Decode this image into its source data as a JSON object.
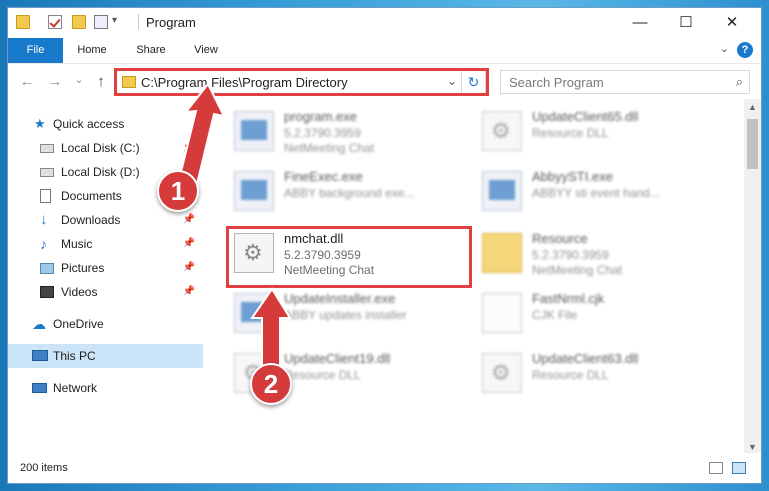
{
  "window": {
    "title": "Program",
    "minimize": "—",
    "maximize": "☐",
    "close": "✕"
  },
  "ribbon": {
    "tabs": [
      "File",
      "Home",
      "Share",
      "View"
    ],
    "help": "?",
    "collapse": "⌄"
  },
  "nav_buttons": {
    "back": "←",
    "forward": "→",
    "recent": "⌄",
    "up": "↑"
  },
  "address": {
    "path": "C:\\Program Files\\Program Directory",
    "dropdown": "⌄",
    "refresh": "↻"
  },
  "search": {
    "placeholder": "Search Program",
    "icon": "⌕"
  },
  "sidebar": {
    "items": [
      {
        "label": "Quick access",
        "icon": "star-icon",
        "pinned": false
      },
      {
        "label": "Local Disk (C:)",
        "icon": "drive-icon",
        "pinned": true
      },
      {
        "label": "Local Disk (D:)",
        "icon": "drive-icon",
        "pinned": true
      },
      {
        "label": "Documents",
        "icon": "documents-icon",
        "pinned": true
      },
      {
        "label": "Downloads",
        "icon": "download-icon",
        "pinned": true
      },
      {
        "label": "Music",
        "icon": "music-icon",
        "pinned": true
      },
      {
        "label": "Pictures",
        "icon": "pictures-icon",
        "pinned": true
      },
      {
        "label": "Videos",
        "icon": "videos-icon",
        "pinned": true
      },
      {
        "label": "OneDrive",
        "icon": "cloud-icon",
        "pinned": false
      },
      {
        "label": "This PC",
        "icon": "computer-icon",
        "pinned": false
      },
      {
        "label": "Network",
        "icon": "network-icon",
        "pinned": false
      }
    ],
    "pin_glyph": "📌"
  },
  "files": [
    {
      "name": "program.exe",
      "line1": "5.2.3790.3959",
      "line2": "NetMeeting Chat",
      "icon": "exe-icon",
      "blurred": true
    },
    {
      "name": "UpdateClient65.dll",
      "line1": "Resource DLL",
      "line2": "",
      "icon": "dll-icon",
      "blurred": true
    },
    {
      "name": "FineExec.exe",
      "line1": "ABBY background exe...",
      "line2": "",
      "icon": "exe-icon",
      "blurred": true
    },
    {
      "name": "AbbyySTI.exe",
      "line1": "ABBYY sti event hand...",
      "line2": "",
      "icon": "exe-icon",
      "blurred": true
    },
    {
      "name": "nmchat.dll",
      "line1": "5.2.3790.3959",
      "line2": "NetMeeting Chat",
      "icon": "dll-icon",
      "blurred": false
    },
    {
      "name": "Resource",
      "line1": "5.2.3790.3959",
      "line2": "NetMeeting Chat",
      "icon": "folder-icon",
      "blurred": true
    },
    {
      "name": "UpdateInstaller.exe",
      "line1": "ABBY updates installer",
      "line2": "",
      "icon": "exe-icon",
      "blurred": true
    },
    {
      "name": "FastNrml.cjk",
      "line1": "CJK File",
      "line2": "",
      "icon": "doc-icon",
      "blurred": true
    },
    {
      "name": "UpdateClient19.dll",
      "line1": "Resource DLL",
      "line2": "",
      "icon": "dll-icon",
      "blurred": true
    },
    {
      "name": "UpdateClient63.dll",
      "line1": "Resource DLL",
      "line2": "",
      "icon": "dll-icon",
      "blurred": true
    }
  ],
  "status": {
    "count": "200 items"
  },
  "annotations": {
    "badge1": "1",
    "badge2": "2",
    "color": "#d63b3b"
  }
}
